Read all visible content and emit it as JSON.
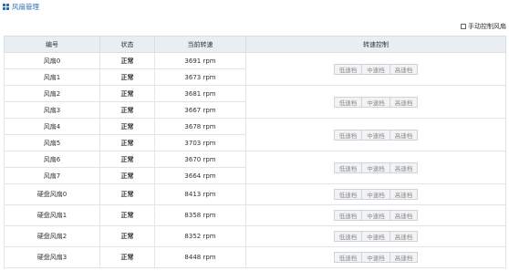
{
  "header": {
    "title": "风扇管理"
  },
  "manual_control": {
    "label": "手动控制风扇",
    "checked": false
  },
  "table": {
    "columns": [
      "编号",
      "状态",
      "当前转速",
      "转速控制"
    ],
    "buttons": [
      "低速档",
      "中速档",
      "高速档"
    ],
    "rows": [
      {
        "id": "风扇0",
        "status": "正常",
        "speed": "3691 rpm"
      },
      {
        "id": "风扇1",
        "status": "正常",
        "speed": "3673 rpm"
      },
      {
        "id": "风扇2",
        "status": "正常",
        "speed": "3681 rpm"
      },
      {
        "id": "风扇3",
        "status": "正常",
        "speed": "3667 rpm"
      },
      {
        "id": "风扇4",
        "status": "正常",
        "speed": "3678 rpm"
      },
      {
        "id": "风扇5",
        "status": "正常",
        "speed": "3703 rpm"
      },
      {
        "id": "风扇6",
        "status": "正常",
        "speed": "3670 rpm"
      },
      {
        "id": "风扇7",
        "status": "正常",
        "speed": "3664 rpm"
      },
      {
        "id": "硬盘风扇0",
        "status": "正常",
        "speed": "8413 rpm"
      },
      {
        "id": "硬盘风扇1",
        "status": "正常",
        "speed": "8358 rpm"
      },
      {
        "id": "硬盘风扇2",
        "status": "正常",
        "speed": "8352 rpm"
      },
      {
        "id": "硬盘风扇3",
        "status": "正常",
        "speed": "8448 rpm"
      }
    ]
  }
}
